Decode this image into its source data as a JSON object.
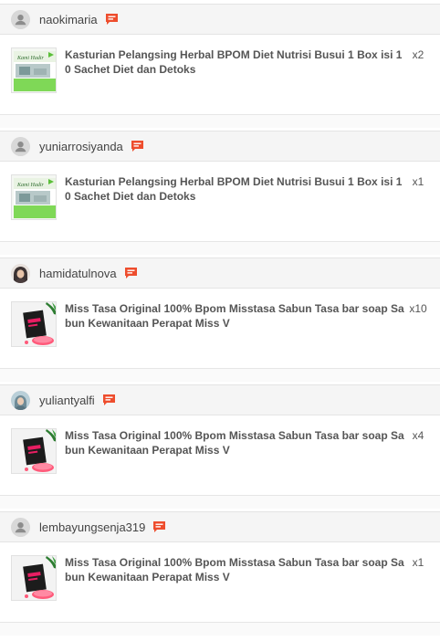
{
  "orders": [
    {
      "username": "naokimaria",
      "avatar": "default-avatar",
      "product": "Kasturian Pelangsing Herbal BPOM Diet Nutrisi Busui 1 Box isi 10 Sachet Diet dan Detoks",
      "quantity": "x2",
      "thumb": "kasturian-box",
      "thumb_text": "Kami Hadir"
    },
    {
      "username": "yuniarrosiyanda",
      "avatar": "default-avatar",
      "product": "Kasturian Pelangsing Herbal BPOM Diet Nutrisi Busui 1 Box isi 10 Sachet Diet dan Detoks",
      "quantity": "x1",
      "thumb": "kasturian-box",
      "thumb_text": "Kami Hadir"
    },
    {
      "username": "hamidatulnova",
      "avatar": "photo-avatar",
      "product": "Miss Tasa Original 100% Bpom Misstasa Sabun Tasa bar soap Sabun Kewanitaan Perapat Miss V",
      "quantity": "x10",
      "thumb": "soap-box"
    },
    {
      "username": "yuliantyalfi",
      "avatar": "photo-avatar",
      "product": "Miss Tasa Original 100% Bpom Misstasa Sabun Tasa bar soap Sabun Kewanitaan Perapat Miss V",
      "quantity": "x4",
      "thumb": "soap-box"
    },
    {
      "username": "lembayungsenja319",
      "avatar": "default-avatar",
      "product": "Miss Tasa Original 100% Bpom Misstasa Sabun Tasa bar soap Sabun Kewanitaan Perapat Miss V",
      "quantity": "x1",
      "thumb": "soap-box"
    }
  ],
  "colors": {
    "chat_icon": "#ee4d2d",
    "header_bg": "#f5f5f5",
    "kasturian_green": "#7fd857"
  }
}
